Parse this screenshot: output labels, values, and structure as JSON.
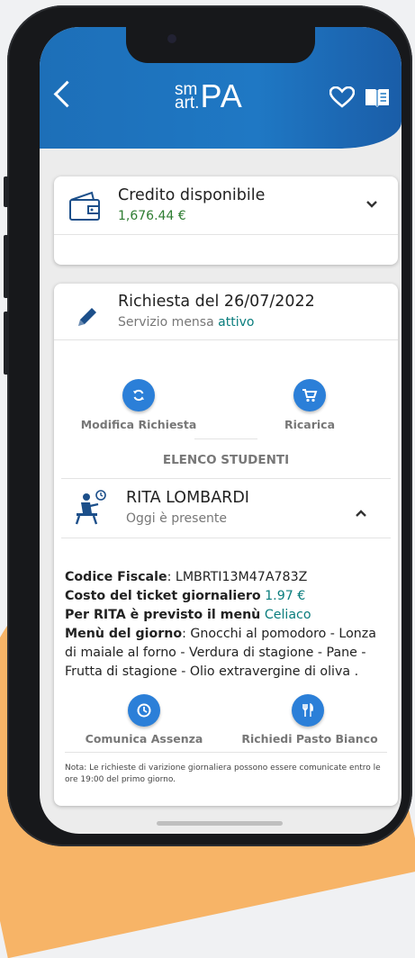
{
  "header": {
    "logo_top": "sm",
    "logo_bottom": "art.",
    "logo_main": "PA"
  },
  "credit": {
    "title": "Credito disponibile",
    "amount": "1,676.44 €"
  },
  "request": {
    "title": "Richiesta del 26/07/2022",
    "service_prefix": "Servizio mensa ",
    "service_status": "attivo",
    "actions": {
      "modify": "Modifica Richiesta",
      "recharge": "Ricarica"
    },
    "students_header": "ELENCO STUDENTI",
    "student": {
      "name": "RITA LOMBARDI",
      "status": "Oggi è presente"
    },
    "details": {
      "fiscal_code_label": "Codice Fiscale",
      "fiscal_code_value": ": LMBRTI13M47A783Z",
      "ticket_label": "Costo del ticket giornaliero",
      "ticket_value": "1.97 €",
      "menu_plan_label": "Per RITA è previsto il menù",
      "menu_plan_value": "Celiaco",
      "menu_label": "Menù del giorno",
      "menu_value": ": Gnocchi al pomodoro - Lonza di maiale al forno - Verdura di stagione - Pane - Frutta di stagione - Olio extravergine di oliva ."
    },
    "student_actions": {
      "absence": "Comunica Assenza",
      "white_meal": "Richiedi Pasto Bianco"
    },
    "note": "Nota: Le richieste di varizione giornaliera possono essere comunicate entro le ore 19:00 del primo giorno."
  },
  "colors": {
    "header_blue": "#1f78c4",
    "action_blue": "#2b7fd8",
    "credit_green": "#2e7d32",
    "accent_teal": "#0a7d7d"
  }
}
